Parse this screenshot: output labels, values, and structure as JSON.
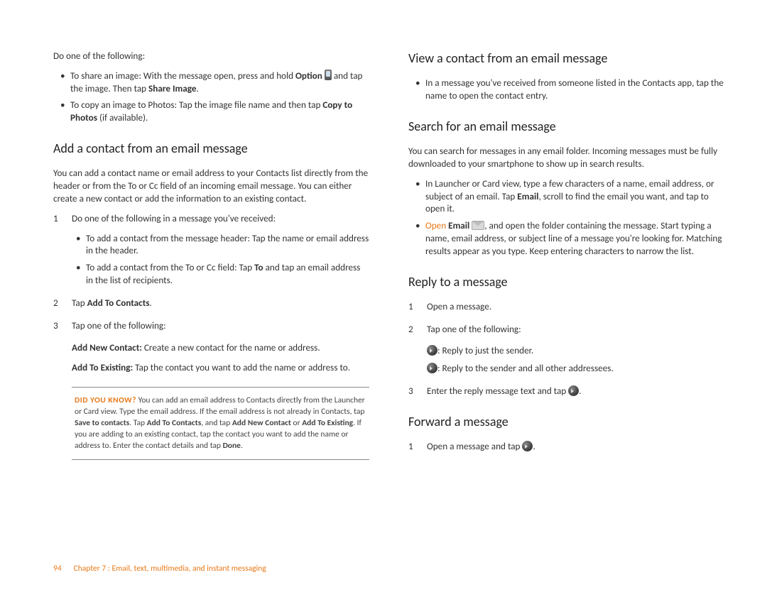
{
  "left": {
    "intro": "Do one of the following:",
    "bullets1": {
      "a_pre": "To share an image: With the message open, press and hold ",
      "a_bold1": "Option",
      "a_mid": " and tap the image. Then tap ",
      "a_bold2": "Share Image",
      "a_post": ".",
      "b_pre": "To copy an image to Photos: Tap the image file name and then tap ",
      "b_bold": "Copy to Photos",
      "b_post": " (if available)."
    },
    "h_add": "Add a contact from an email message",
    "add_para": "You can add a contact name or email address to your Contacts list directly from the header or from the To or Cc field of an incoming email message. You can either create a new contact or add the information to an existing contact.",
    "step1": "Do one of the following in a message you've received:",
    "step1_sub": {
      "a": "To add a contact from the message header: Tap the name or email address in the header.",
      "b_pre": "To add a contact from the To or Cc field: Tap ",
      "b_bold": "To",
      "b_post": " and tap an email address in the list of recipients."
    },
    "step2_pre": "Tap ",
    "step2_bold": "Add To Contacts",
    "step2_post": ".",
    "step3": "Tap one of the following:",
    "step3_opts": {
      "a_bold": "Add New Contact:",
      "a_rest": " Create a new contact for the name or address.",
      "b_bold": "Add To Existing:",
      "b_rest": " Tap the contact you want to add the name or address to."
    },
    "tip": {
      "lead": "DID YOU KNOW?",
      "t1": " You can add an email address to Contacts directly from the Launcher or Card view. Type the email address. If the email address is not already in Contacts, tap ",
      "b1": "Save to contacts",
      "t2": ". Tap ",
      "b2": "Add To Contacts",
      "t3": ", and tap ",
      "b3": "Add New Contact",
      "t4": " or ",
      "b4": "Add To Existing",
      "t5": ". If you are adding to an existing contact, tap the contact you want to add the name or address to. Enter the contact details and tap ",
      "b5": "Done",
      "t6": "."
    }
  },
  "right": {
    "h_view": "View a contact from an email message",
    "view_b": "In a message you've received from someone listed in the Contacts app, tap the name to open the contact entry.",
    "h_search": "Search for an email message",
    "search_para": "You can search for messages in any email folder. Incoming messages must be fully downloaded to your smartphone to show up in search results.",
    "search_b1_pre": "In Launcher or Card view, type a few characters of a name, email address, or subject of an email. Tap ",
    "search_b1_bold": "Email",
    "search_b1_post": ", scroll to find the email you want, and tap to open it.",
    "search_b2_link": "Open",
    "search_b2_bold": " Email",
    "search_b2_post": ", and open the folder containing the message. Start typing a name, email address, or subject line of a message you're looking for. Matching results appear as you type. Keep entering characters to narrow the list.",
    "h_reply": "Reply to a message",
    "reply_s1": "Open a message.",
    "reply_s2": "Tap one of the following:",
    "reply_s2a": ": Reply to just the sender.",
    "reply_s2b": ": Reply to the sender and all other addressees.",
    "reply_s3_pre": "Enter the reply message text and tap ",
    "reply_s3_post": ".",
    "h_forward": "Forward a message",
    "fwd_s1_pre": "Open a message and tap ",
    "fwd_s1_post": "."
  },
  "footer": {
    "page": "94",
    "chapter": "Chapter 7 : Email, text, multimedia, and instant messaging"
  }
}
